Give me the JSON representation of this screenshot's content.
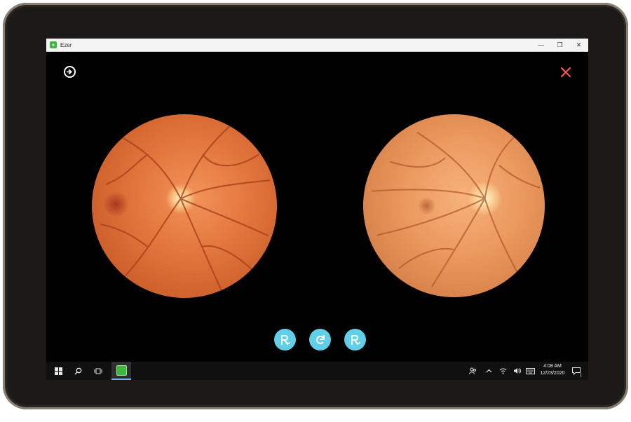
{
  "window": {
    "title": "Ezer",
    "controls": {
      "minimize": "—",
      "restore": "❐",
      "close": "✕"
    }
  },
  "app": {
    "next_icon": "arrow-right-circle-icon",
    "close_icon": "close-x-icon",
    "accent_close": "#ff5a5a",
    "images": [
      {
        "name": "left-fundus-image",
        "eye": "left-side"
      },
      {
        "name": "right-fundus-image",
        "eye": "right-side"
      }
    ],
    "toolbar": [
      {
        "name": "rx-left-button",
        "icon": "rx-icon"
      },
      {
        "name": "refresh-button",
        "icon": "refresh-icon"
      },
      {
        "name": "rx-right-button",
        "icon": "rx-icon"
      }
    ],
    "accent_tool": "#5fd0e8"
  },
  "taskbar": {
    "time": "4:08 AM",
    "date": "12/23/2020",
    "notification_count": "1",
    "icons": [
      "windows-start-icon",
      "search-icon",
      "task-view-icon",
      "ezer-app-icon",
      "people-icon",
      "chevron-up-icon",
      "wifi-icon",
      "volume-icon",
      "keyboard-icon",
      "notification-icon"
    ]
  }
}
